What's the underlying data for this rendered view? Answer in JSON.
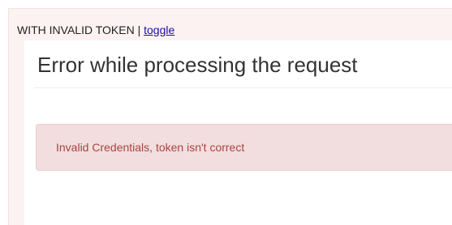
{
  "header": {
    "label": "WITH INVALID TOKEN",
    "separator": " | ",
    "toggle_link": "toggle"
  },
  "main": {
    "title": "Error while processing the request",
    "alert": {
      "message": "Invalid Credentials, token isn't correct",
      "status": "error"
    }
  },
  "colors": {
    "outer_background": "#fdf2f2",
    "alert_background": "#f2dede",
    "alert_border": "#ebccd1",
    "alert_text": "#a94442",
    "link": "#1a0dab"
  }
}
